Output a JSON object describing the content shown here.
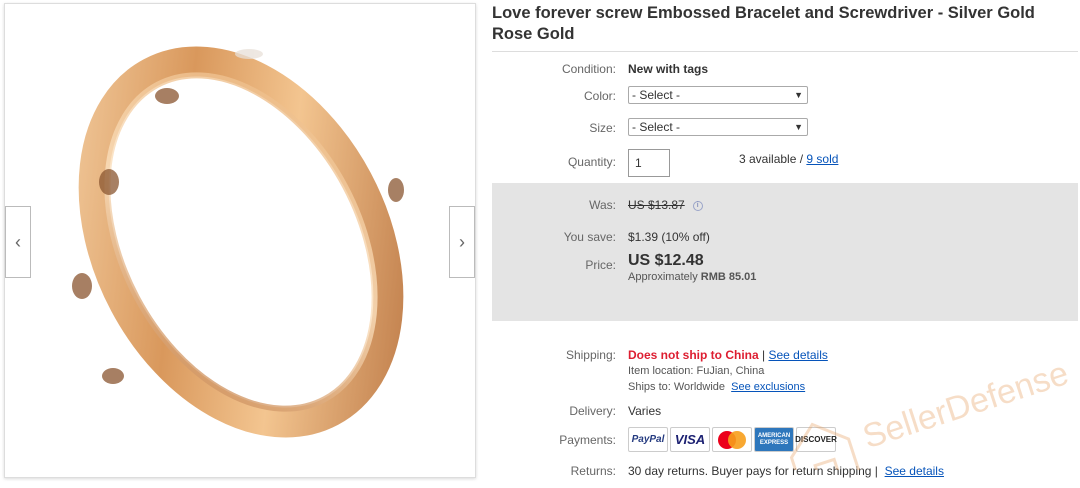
{
  "product": {
    "title": "Love forever screw Embossed Bracelet and Screwdriver - Silver Gold Rose Gold"
  },
  "nav": {
    "prev_icon": "‹",
    "next_icon": "›"
  },
  "details": {
    "condition_label": "Condition:",
    "condition_value": "New with tags",
    "color_label": "Color:",
    "color_selected": "- Select -",
    "size_label": "Size:",
    "size_selected": "- Select -",
    "quantity_label": "Quantity:",
    "quantity_value": "1",
    "available_text": "3 available /",
    "sold_link": "9 sold"
  },
  "pricing": {
    "was_label": "Was:",
    "was_value": "US $13.87",
    "save_label": "You save:",
    "save_value": "$1.39 (10% off)",
    "price_label": "Price:",
    "price_value": "US $12.48",
    "approx_text": "Approximately",
    "approx_value": "RMB 85.01"
  },
  "shipping": {
    "shipping_label": "Shipping:",
    "shipping_status": "Does not ship to China",
    "sep": "|",
    "see_details": "See details",
    "location_label": "Item location:",
    "location_value": "FuJian, China",
    "ships_to_label": "Ships to:",
    "ships_to_value": "Worldwide",
    "see_exclusions": "See exclusions",
    "delivery_label": "Delivery:",
    "delivery_value": "Varies",
    "payments_label": "Payments:",
    "returns_label": "Returns:",
    "returns_value": "30 day returns. Buyer pays for return shipping |",
    "returns_link": "See details"
  },
  "payment_methods": {
    "paypal": "PayPal",
    "visa": "VISA",
    "mastercard": "MasterCard",
    "amex": "AMERICAN EXPRESS",
    "discover": "DISCOVER"
  },
  "watermark": {
    "text": "SellerDefense"
  },
  "colors": {
    "link": "#0654ba",
    "ship_warning": "#dd1e31",
    "price_box": "#e4e4e4"
  }
}
